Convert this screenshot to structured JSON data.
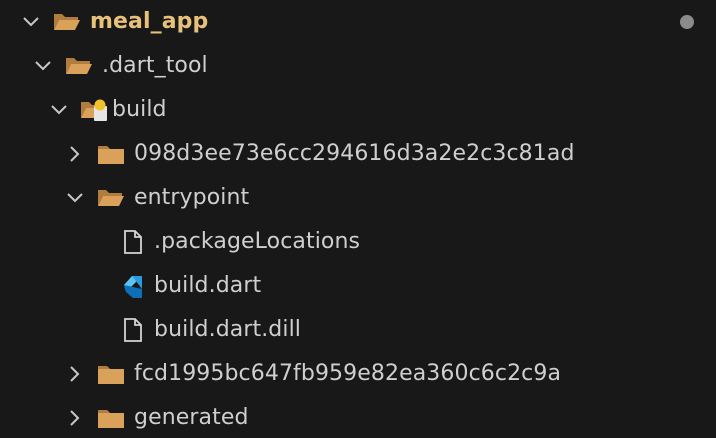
{
  "explorer": {
    "items": [
      {
        "label": "meal_app",
        "kind": "folder-open",
        "expanded": true,
        "depth": 0,
        "root": true,
        "modified": true
      },
      {
        "label": ".dart_tool",
        "kind": "folder-open",
        "expanded": true,
        "depth": 1
      },
      {
        "label": "build",
        "kind": "folder-build",
        "expanded": true,
        "depth": 2
      },
      {
        "label": "098d3ee73e6cc294616d3a2e2c3c81ad",
        "kind": "folder",
        "expanded": false,
        "depth": 3
      },
      {
        "label": "entrypoint",
        "kind": "folder-open",
        "expanded": true,
        "depth": 3
      },
      {
        "label": ".packageLocations",
        "kind": "file",
        "depth": 4
      },
      {
        "label": "build.dart",
        "kind": "dart-file",
        "depth": 4
      },
      {
        "label": "build.dart.dill",
        "kind": "file",
        "depth": 4
      },
      {
        "label": "fcd1995bc647fb959e82ea360c6c2c9a",
        "kind": "folder",
        "expanded": false,
        "depth": 3
      },
      {
        "label": "generated",
        "kind": "folder",
        "expanded": false,
        "depth": 3
      }
    ]
  },
  "colors": {
    "background": "#181818",
    "folder": "#d9a15a",
    "root_label": "#e8c17a",
    "text": "#cfcfcf",
    "chevron": "#c8c8c8",
    "modified_dot": "#8b8b8b",
    "dart_dark": "#0d6fb8",
    "dart_light": "#5cc2f0",
    "file_outline": "#d4d4d4"
  }
}
